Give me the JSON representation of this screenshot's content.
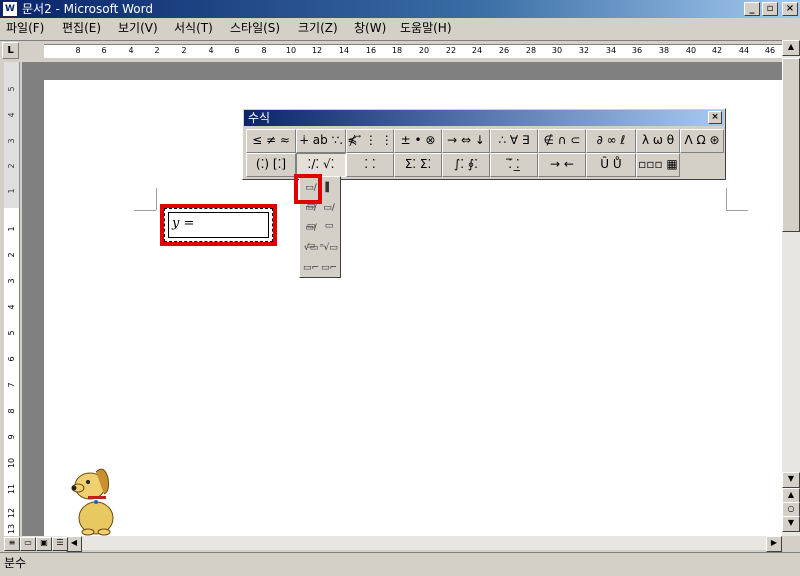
{
  "window": {
    "title": "문서2 - Microsoft Word",
    "app_icon": "word-icon",
    "buttons": {
      "minimize": "_",
      "restore": "▫",
      "close": "×"
    }
  },
  "menu": [
    {
      "label": "파일(F)"
    },
    {
      "label": "편집(E)"
    },
    {
      "label": "보기(V)"
    },
    {
      "label": "서식(T)"
    },
    {
      "label": "스타일(S)"
    },
    {
      "label": "크기(Z)"
    },
    {
      "label": "창(W)"
    },
    {
      "label": "도움말(H)"
    }
  ],
  "ruler": {
    "corner": "L",
    "h_labels": [
      "8",
      "6",
      "4",
      "2",
      "2",
      "4",
      "6",
      "8",
      "10",
      "12",
      "14",
      "16",
      "18",
      "20",
      "22",
      "24",
      "26",
      "28",
      "30",
      "32",
      "34",
      "36",
      "38",
      "40",
      "42",
      "44",
      "46"
    ],
    "v_labels": [
      "5",
      "4",
      "3",
      "2",
      "1",
      "1",
      "2",
      "3",
      "4",
      "5",
      "6",
      "7",
      "8",
      "9",
      "10",
      "11",
      "12",
      "13"
    ]
  },
  "equation": {
    "text": "y ="
  },
  "eq_toolbar": {
    "title": "수식",
    "close": "×",
    "row1": [
      "≤ ≠ ≈",
      "∔ ab ∵.",
      "⋠ ⃗ ⋮ ⋮",
      "± • ⊗",
      "→ ⇔ ↓",
      "∴ ∀ ∃",
      "∉ ∩ ⊂",
      "∂ ∞ ℓ",
      "λ ω θ",
      "Λ Ω ⊛"
    ],
    "row2": [
      "(⁚) [⁚]",
      "⁚/⁚ √⁚",
      "⁚ ⁚",
      "Σ⁚ Σ⁚",
      "∫⁚ ∮⁚",
      "⁚̅ ⁚̲",
      "→ ←",
      "Ū Ů",
      "▫▫▫ ▦"
    ]
  },
  "fraction_menu": [
    "▭/▭",
    "▌",
    "▭/▭",
    "▭/▭",
    "▭/▭",
    "",
    "√▭",
    "ⁿ√▭",
    "▭⌐",
    "▭⌐"
  ],
  "status": {
    "text": "분수"
  }
}
